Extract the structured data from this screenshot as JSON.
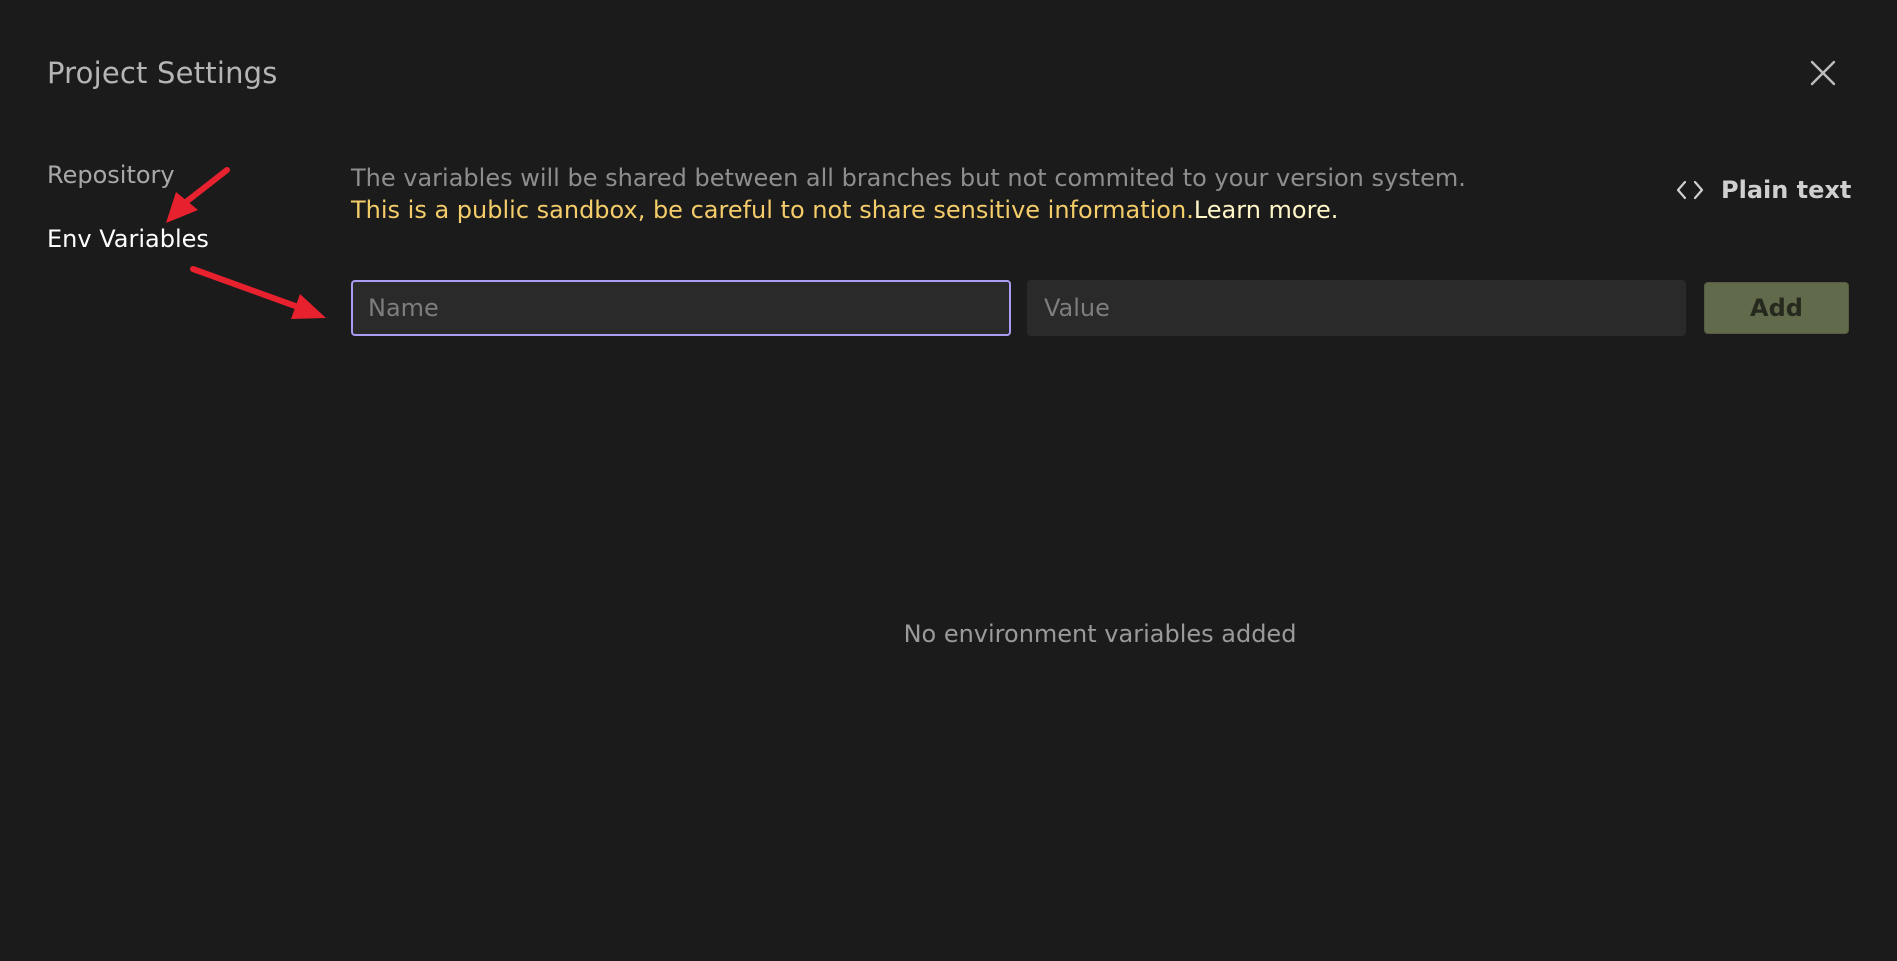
{
  "dialog": {
    "title": "Project Settings",
    "close_icon": "close-icon"
  },
  "sidebar": {
    "items": [
      {
        "label": "Repository",
        "active": false
      },
      {
        "label": "Env Variables",
        "active": true
      }
    ]
  },
  "content": {
    "description": "The variables will be shared between all branches but not commited to your version system.",
    "warning": "This is a public sandbox, be careful to not share sensitive information.",
    "learn_more": "Learn more.",
    "plain_text_button": {
      "label": "Plain text",
      "icon": "code-icon"
    },
    "form": {
      "name_placeholder": "Name",
      "name_value": "",
      "value_placeholder": "Value",
      "value_value": "",
      "add_label": "Add"
    },
    "empty_message": "No environment variables added"
  },
  "annotations": {
    "arrow_color": "#e8212e",
    "count": 2
  },
  "colors": {
    "background": "#1b1b1b",
    "focus_border": "#ab9bf2",
    "warning_text": "#f4cd6a",
    "learn_more_text": "#fff6c7",
    "add_button_bg": "#616b4c"
  }
}
